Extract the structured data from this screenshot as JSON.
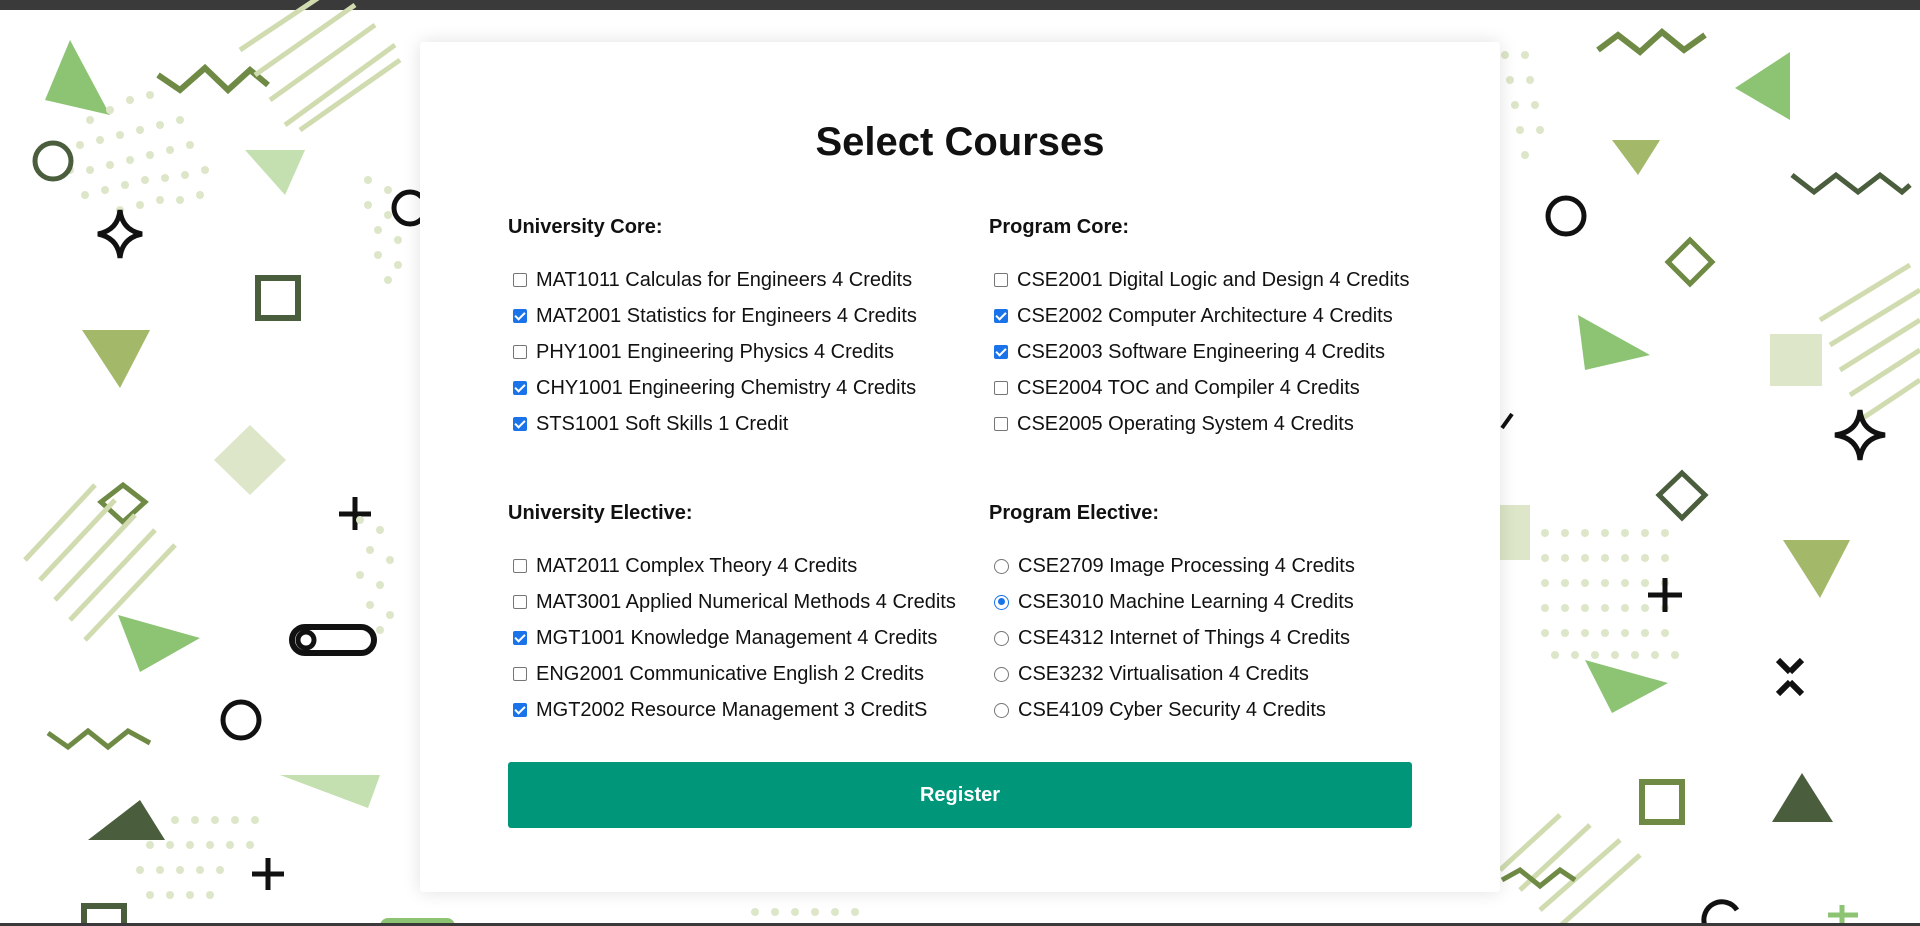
{
  "page": {
    "title": "Select Courses"
  },
  "sections": {
    "university_core": {
      "title": "University Core:",
      "items": [
        {
          "label": "MAT1011 Calculas for Engineers 4 Credits",
          "checked": false
        },
        {
          "label": "MAT2001 Statistics for Engineers 4 Credits",
          "checked": true
        },
        {
          "label": "PHY1001 Engineering Physics 4 Credits",
          "checked": false
        },
        {
          "label": "CHY1001 Engineering Chemistry 4 Credits",
          "checked": true
        },
        {
          "label": "STS1001 Soft Skills 1 Credit",
          "checked": true
        }
      ]
    },
    "program_core": {
      "title": "Program Core:",
      "items": [
        {
          "label": "CSE2001 Digital Logic and Design 4 Credits",
          "checked": false
        },
        {
          "label": "CSE2002 Computer Architecture 4 Credits",
          "checked": true
        },
        {
          "label": "CSE2003 Software Engineering 4 Credits",
          "checked": true
        },
        {
          "label": "CSE2004 TOC and Compiler 4 Credits",
          "checked": false
        },
        {
          "label": "CSE2005 Operating System 4 Credits",
          "checked": false
        }
      ]
    },
    "university_elective": {
      "title": "University Elective:",
      "items": [
        {
          "label": "MAT2011 Complex Theory 4 Credits",
          "checked": false
        },
        {
          "label": "MAT3001 Applied Numerical Methods 4 Credits",
          "checked": false
        },
        {
          "label": "MGT1001 Knowledge Management 4 Credits",
          "checked": true
        },
        {
          "label": "ENG2001 Communicative English 2 Credits",
          "checked": false
        },
        {
          "label": "MGT2002 Resource Management 3 CreditS",
          "checked": true
        }
      ]
    },
    "program_elective": {
      "title": "Program Elective:",
      "items": [
        {
          "label": "CSE2709 Image Processing 4 Credits",
          "checked": false
        },
        {
          "label": "CSE3010 Machine Learning 4 Credits",
          "checked": true
        },
        {
          "label": "CSE4312 Internet of Things 4 Credits",
          "checked": false
        },
        {
          "label": "CSE3232 Virtualisation 4 Credits",
          "checked": false
        },
        {
          "label": "CSE4109 Cyber Security 4 Credits",
          "checked": false
        }
      ]
    }
  },
  "register_label": "Register",
  "colors": {
    "accent": "#00967a",
    "check": "#1a73e8",
    "bg_green_light": "#dde6c8",
    "bg_green_mid": "#8cc474",
    "bg_green_olive": "#a4b86a",
    "bg_green_dark": "#4a5e3e"
  }
}
